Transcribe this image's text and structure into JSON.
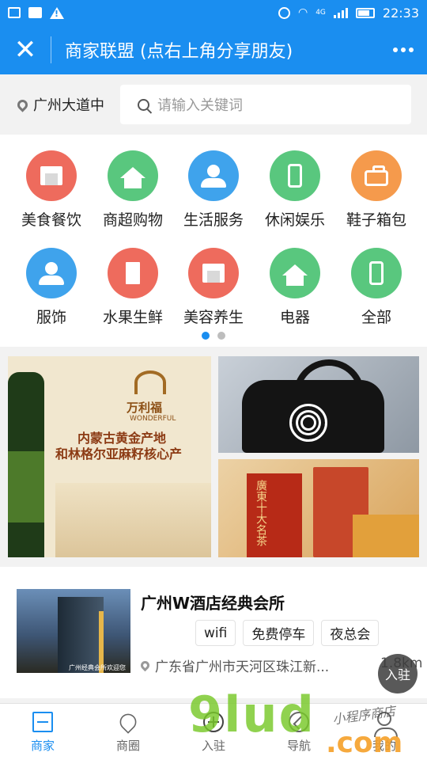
{
  "status_bar": {
    "time": "22:33",
    "network": "4G",
    "icons": [
      "sms-icon",
      "image-icon",
      "warning-icon",
      "alarm-icon",
      "wifi-icon",
      "signal-icon",
      "battery-icon"
    ]
  },
  "header": {
    "title": "商家联盟 (点右上角分享朋友)",
    "close_icon": "close-icon",
    "more_icon": "more-icon"
  },
  "search": {
    "location": "广州大道中",
    "placeholder": "请输入关键词"
  },
  "categories": [
    {
      "label": "美食餐饮",
      "icon": "store-icon",
      "color": "#ee6b5d"
    },
    {
      "label": "商超购物",
      "icon": "house-icon",
      "color": "#59c77e"
    },
    {
      "label": "生活服务",
      "icon": "person-icon",
      "color": "#3fa3ec"
    },
    {
      "label": "休闲娱乐",
      "icon": "phone-icon",
      "color": "#59c77e"
    },
    {
      "label": "鞋子箱包",
      "icon": "bag-icon",
      "color": "#f59a4c"
    },
    {
      "label": "服饰",
      "icon": "person-icon",
      "color": "#3fa3ec"
    },
    {
      "label": "水果生鲜",
      "icon": "building-icon",
      "color": "#ee6b5d"
    },
    {
      "label": "美容养生",
      "icon": "store-icon",
      "color": "#ee6b5d"
    },
    {
      "label": "电器",
      "icon": "house-icon",
      "color": "#59c77e"
    },
    {
      "label": "全部",
      "icon": "phone-icon",
      "color": "#59c77e"
    }
  ],
  "pager": {
    "active_color": "#1a8ef0",
    "inactive_color": "#bdbdbd",
    "pages": 2,
    "current": 1
  },
  "banners": {
    "left": {
      "brand": "万利福",
      "brand_en": "WONDERFUL",
      "line1": "内蒙古黄金产地",
      "line2": "和林格尔亚麻籽核心产"
    },
    "right_bottom": {
      "box_text": "廣東十大名茶"
    }
  },
  "merchant": {
    "name": "广州W酒店经典会所",
    "tags": [
      "wifi",
      "免费停车",
      "夜总会"
    ],
    "address": "广东省广州市天河区珠江新...",
    "distance": "1.8km",
    "thumb_caption": "广州经典会所欢迎您"
  },
  "join_button": "入驻",
  "tabs": [
    {
      "label": "商家",
      "icon": "shop-icon",
      "active": true
    },
    {
      "label": "商圈",
      "icon": "map-pin-icon",
      "active": false
    },
    {
      "label": "入驻",
      "icon": "plus-circle-icon",
      "active": false
    },
    {
      "label": "导航",
      "icon": "navigation-icon",
      "active": false
    },
    {
      "label": "我的",
      "icon": "user-icon",
      "active": false
    }
  ],
  "watermark": {
    "main": "9lud",
    "suffix": ".com",
    "script": "小程序商店"
  },
  "colors": {
    "brand_blue": "#1a8ef0"
  }
}
